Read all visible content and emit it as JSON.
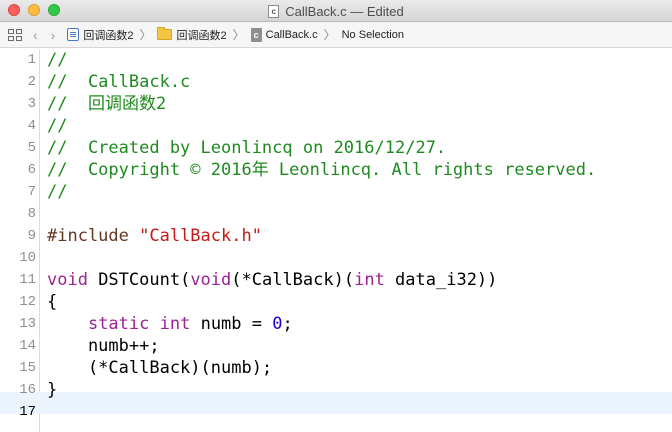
{
  "window": {
    "title": "CallBack.c — Edited",
    "file_badge": "c"
  },
  "jumpbar": {
    "crumbs": [
      "回调函数2",
      "回调函数2",
      "CallBack.c",
      "No Selection"
    ],
    "file_badge": "c"
  },
  "editor": {
    "current_line": 17,
    "lines": [
      {
        "n": "1",
        "tokens": [
          {
            "t": "//",
            "c": "cm"
          }
        ]
      },
      {
        "n": "2",
        "tokens": [
          {
            "t": "//  CallBack.c",
            "c": "cm"
          }
        ]
      },
      {
        "n": "3",
        "tokens": [
          {
            "t": "//  回调函数2",
            "c": "cm"
          }
        ]
      },
      {
        "n": "4",
        "tokens": [
          {
            "t": "//",
            "c": "cm"
          }
        ]
      },
      {
        "n": "5",
        "tokens": [
          {
            "t": "//  Created by Leonlincq on 2016/12/27.",
            "c": "cm"
          }
        ]
      },
      {
        "n": "6",
        "tokens": [
          {
            "t": "//  Copyright © 2016年 Leonlincq. All rights reserved.",
            "c": "cm"
          }
        ]
      },
      {
        "n": "7",
        "tokens": [
          {
            "t": "//",
            "c": "cm"
          }
        ]
      },
      {
        "n": "8",
        "tokens": []
      },
      {
        "n": "9",
        "tokens": [
          {
            "t": "#include ",
            "c": "pp"
          },
          {
            "t": "\"CallBack.h\"",
            "c": "st"
          }
        ]
      },
      {
        "n": "10",
        "tokens": []
      },
      {
        "n": "11",
        "tokens": [
          {
            "t": "void",
            "c": "kw"
          },
          {
            "t": " DSTCount(",
            "c": "pl"
          },
          {
            "t": "void",
            "c": "kw"
          },
          {
            "t": "(*CallBack)(",
            "c": "pl"
          },
          {
            "t": "int",
            "c": "kw"
          },
          {
            "t": " data_i32))",
            "c": "pl"
          }
        ]
      },
      {
        "n": "12",
        "tokens": [
          {
            "t": "{",
            "c": "pl"
          }
        ]
      },
      {
        "n": "13",
        "tokens": [
          {
            "t": "    ",
            "c": "pl"
          },
          {
            "t": "static",
            "c": "kw"
          },
          {
            "t": " ",
            "c": "pl"
          },
          {
            "t": "int",
            "c": "kw"
          },
          {
            "t": " numb = ",
            "c": "pl"
          },
          {
            "t": "0",
            "c": "nm"
          },
          {
            "t": ";",
            "c": "pl"
          }
        ]
      },
      {
        "n": "14",
        "tokens": [
          {
            "t": "    numb++;",
            "c": "pl"
          }
        ]
      },
      {
        "n": "15",
        "tokens": [
          {
            "t": "    (*CallBack)(numb);",
            "c": "pl"
          }
        ]
      },
      {
        "n": "16",
        "tokens": [
          {
            "t": "}",
            "c": "pl"
          }
        ]
      },
      {
        "n": "17",
        "tokens": []
      }
    ]
  },
  "colors": {
    "comment": "#1f8a1f",
    "keyword": "#9b2393",
    "string": "#c41a16",
    "preprocessor": "#643820",
    "number": "#1c00cf",
    "current_line_bg": "#ecf5ff"
  }
}
